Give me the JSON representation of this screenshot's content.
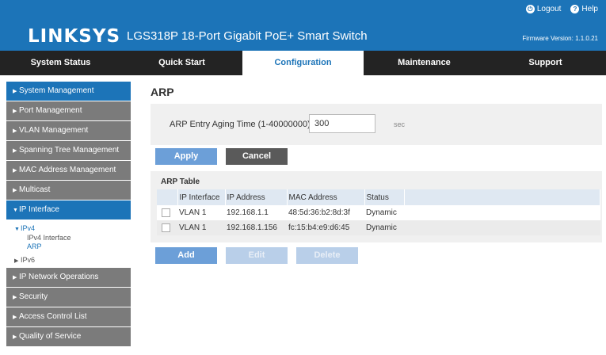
{
  "header": {
    "logo": "LINKSYS",
    "model": "LGS318P 18-Port Gigabit PoE+ Smart Switch",
    "logout": "Logout",
    "help": "Help",
    "firmware": "Firmware Version: 1.1.0.21",
    "brand_color": "#1c74b8"
  },
  "nav": {
    "tabs": [
      {
        "label": "System Status"
      },
      {
        "label": "Quick Start"
      },
      {
        "label": "Configuration"
      },
      {
        "label": "Maintenance"
      },
      {
        "label": "Support"
      }
    ],
    "active": "Configuration"
  },
  "sidebar": {
    "items": [
      {
        "label": "System Management"
      },
      {
        "label": "Port Management"
      },
      {
        "label": "VLAN Management"
      },
      {
        "label": "Spanning Tree Management"
      },
      {
        "label": "MAC Address Management"
      },
      {
        "label": "Multicast"
      },
      {
        "label": "IP Interface"
      },
      {
        "label": "IP Network Operations"
      },
      {
        "label": "Security"
      },
      {
        "label": "Access Control List"
      },
      {
        "label": "Quality of Service"
      }
    ],
    "sub": {
      "ipv4": "IPv4",
      "ipv4_interface": "IPv4 Interface",
      "arp": "ARP",
      "ipv6": "IPv6"
    }
  },
  "main": {
    "title": "ARP",
    "aging_label": "ARP Entry Aging Time (1-40000000):",
    "aging_value": "300",
    "aging_unit": "sec",
    "apply": "Apply",
    "cancel": "Cancel",
    "table_title": "ARP Table",
    "columns": [
      "IP Interface",
      "IP Address",
      "MAC Address",
      "Status"
    ],
    "rows": [
      {
        "interface": "VLAN 1",
        "ip": "192.168.1.1",
        "mac": "48:5d:36:b2:8d:3f",
        "status": "Dynamic"
      },
      {
        "interface": "VLAN 1",
        "ip": "192.168.1.156",
        "mac": "fc:15:b4:e9:d6:45",
        "status": "Dynamic"
      }
    ],
    "add": "Add",
    "edit": "Edit",
    "delete": "Delete"
  }
}
